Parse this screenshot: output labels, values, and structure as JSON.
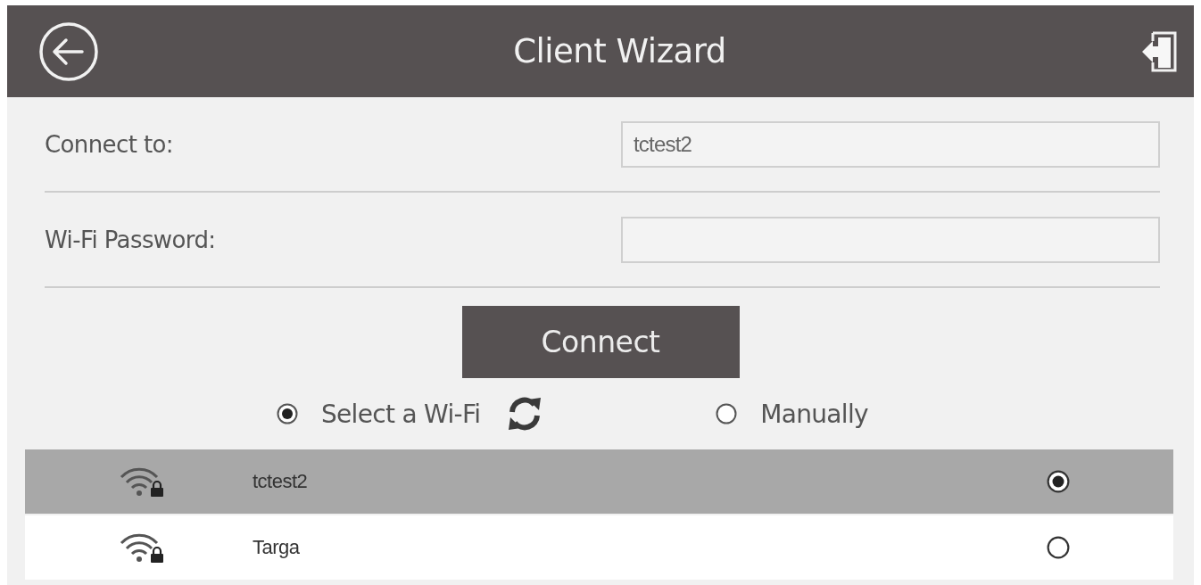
{
  "header": {
    "title": "Client Wizard"
  },
  "fields": [
    {
      "label": "Connect to:",
      "value": "tctest2"
    },
    {
      "label": "Wi-Fi Password:"
    }
  ],
  "connect_button": {
    "label": "Connect"
  },
  "modes": [
    {
      "label": "Select a Wi-Fi",
      "selected": true,
      "refresh_button": true
    },
    {
      "label": "Manually",
      "selected": false,
      "refresh_button": false
    }
  ],
  "networks": [
    {
      "ssid": "tctest2",
      "secured": true,
      "selected": true
    },
    {
      "ssid": "Targa",
      "secured": true,
      "selected": false
    }
  ]
}
